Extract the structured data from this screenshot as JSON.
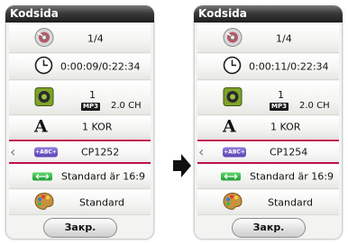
{
  "left_panel": {
    "title": "Kodsida",
    "rows": {
      "disc": "1/4",
      "time": "0:00:09/0:22:34",
      "audio": {
        "track": "1",
        "format": "MP3",
        "channels": "2.0 CH"
      },
      "subtitle": "1 KOR",
      "codepage": {
        "badge": "+ABC+",
        "value": "CP1252"
      },
      "ratio": "Standard är 16:9",
      "color": "Standard"
    },
    "close_label": "Закр."
  },
  "right_panel": {
    "title": "Kodsida",
    "rows": {
      "disc": "1/4",
      "time": "0:00:11/0:22:34",
      "audio": {
        "track": "1",
        "format": "MP3",
        "channels": "2.0 CH"
      },
      "subtitle": "1 KOR",
      "codepage": {
        "badge": "+ABC+",
        "value": "CP1254"
      },
      "ratio": "Standard är 16:9",
      "color": "Standard"
    },
    "close_label": "Закр."
  },
  "colors": {
    "selection": "#c0114f",
    "titlebar": "#1e1e1e",
    "codepage_badge": "#6a55c4",
    "ratio_badge": "#2fae3f"
  },
  "icons": {
    "disc": "disc-icon",
    "time": "clock-icon",
    "audio": "speaker-icon",
    "subtitle": "font-a-icon",
    "codepage": "abc-codepage-icon",
    "ratio": "aspect-ratio-icon",
    "color": "palette-icon",
    "transition": "right-arrow-icon"
  }
}
